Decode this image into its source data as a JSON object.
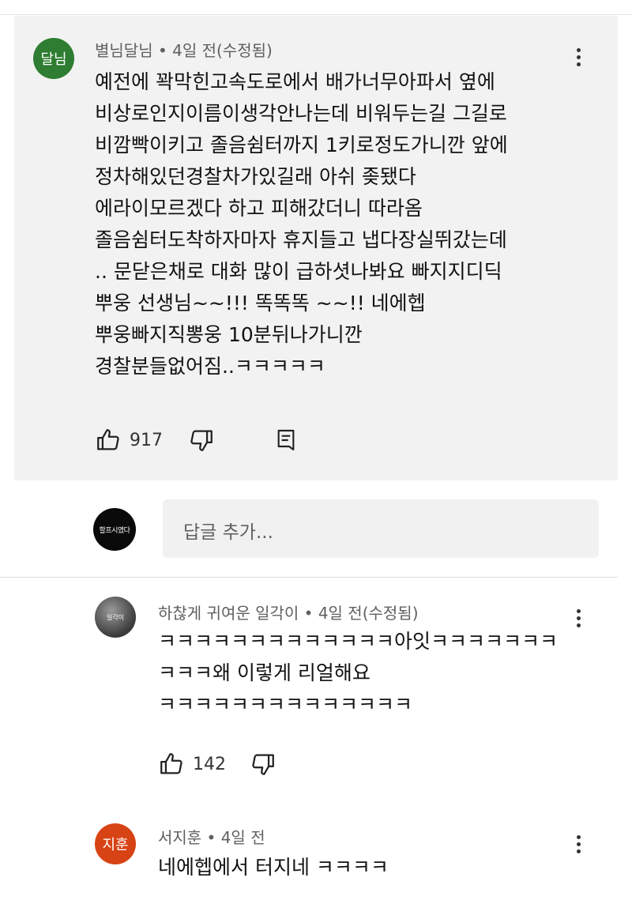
{
  "comments": [
    {
      "avatar_text": "달님",
      "avatar_color": "#2e7d32",
      "meta": "별님달님 • 4일 전(수정됨)",
      "lines": [
        "예전에 꽉막힌고속도로에서 배가너무아파서 옆에",
        "비상로인지이름이생각안나는데 비워두는길 그길로",
        "비깜빡이키고 졸음쉼터까지 1키로정도가니깐 앞에",
        "정차해있던경찰차가있길래 아쉬 좆됐다",
        "에라이모르겠다 하고 피해갔더니 따라옴",
        "졸음쉼터도착하자마자 휴지들고 냅다장실뛰갔는데",
        ".. 문닫은채로 대화 많이 급하셧나봐요 빠지지디딕",
        "뿌웅 선생님~~!!! 똑똑똑 ~~!! 네에헵",
        "뿌웅빠지직뽕웅 10분뒤나가니깐",
        "경찰분들없어짐..ㅋㅋㅋㅋㅋ"
      ],
      "likes": "917"
    },
    {
      "avatar_text": "일각이",
      "avatar_color": "#3a3a3a",
      "meta": "하찮게 귀여운 일각이 • 4일 전(수정됨)",
      "lines": [
        "ㅋㅋㅋㅋㅋㅋㅋㅋㅋㅋㅋㅋㅋ아잇ㅋㅋㅋㅋㅋㅋㅋ",
        "ㅋㅋㅋ왜 이렇게 리얼해요",
        "ㅋㅋㅋㅋㅋㅋㅋㅋㅋㅋㅋㅋㅋㅋ"
      ],
      "likes": "142"
    },
    {
      "avatar_text": "지훈",
      "avatar_color": "#d84315",
      "meta": "서지훈 • 4일 전",
      "lines": [
        "네에헵에서 터지네 ㅋㅋㅋㅋ"
      ]
    }
  ],
  "reply": {
    "avatar_text": "할프시였다",
    "placeholder": "답글 추가..."
  }
}
